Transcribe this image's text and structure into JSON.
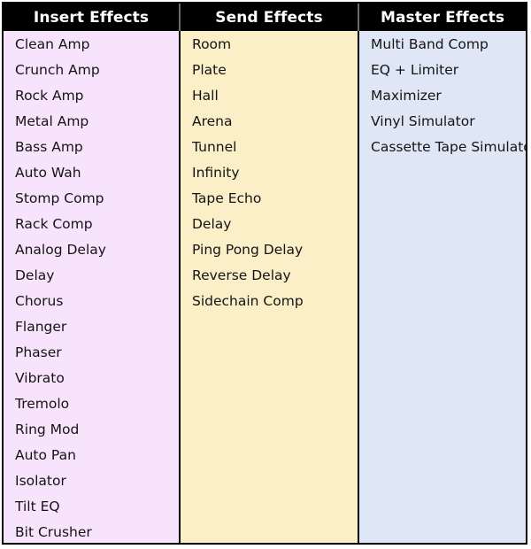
{
  "table": {
    "columns": [
      {
        "key": "insert",
        "header": "Insert Effects",
        "accent_color": "#f7e4fc",
        "items": [
          "Clean Amp",
          "Crunch Amp",
          "Rock Amp",
          "Metal Amp",
          "Bass Amp",
          "Auto Wah",
          "Stomp Comp",
          "Rack Comp",
          "Analog Delay",
          "Delay",
          "Chorus",
          "Flanger",
          "Phaser",
          "Vibrato",
          "Tremolo",
          "Ring Mod",
          "Auto Pan",
          "Isolator",
          "Tilt EQ",
          "Bit Crusher"
        ]
      },
      {
        "key": "send",
        "header": "Send Effects",
        "accent_color": "#fbefc8",
        "items": [
          "Room",
          "Plate",
          "Hall",
          "Arena",
          "Tunnel",
          "Infinity",
          "Tape Echo",
          "Delay",
          "Ping Pong Delay",
          "Reverse Delay",
          "Sidechain Comp"
        ]
      },
      {
        "key": "master",
        "header": "Master Effects",
        "accent_color": "#dfe6f5",
        "items": [
          "Multi Band Comp",
          "EQ + Limiter",
          "Maximizer",
          "Vinyl Simulator",
          "Cassette Tape Simulator"
        ]
      }
    ],
    "header_background": "#000000",
    "header_text_color": "#ffffff",
    "border_color": "#000000"
  }
}
